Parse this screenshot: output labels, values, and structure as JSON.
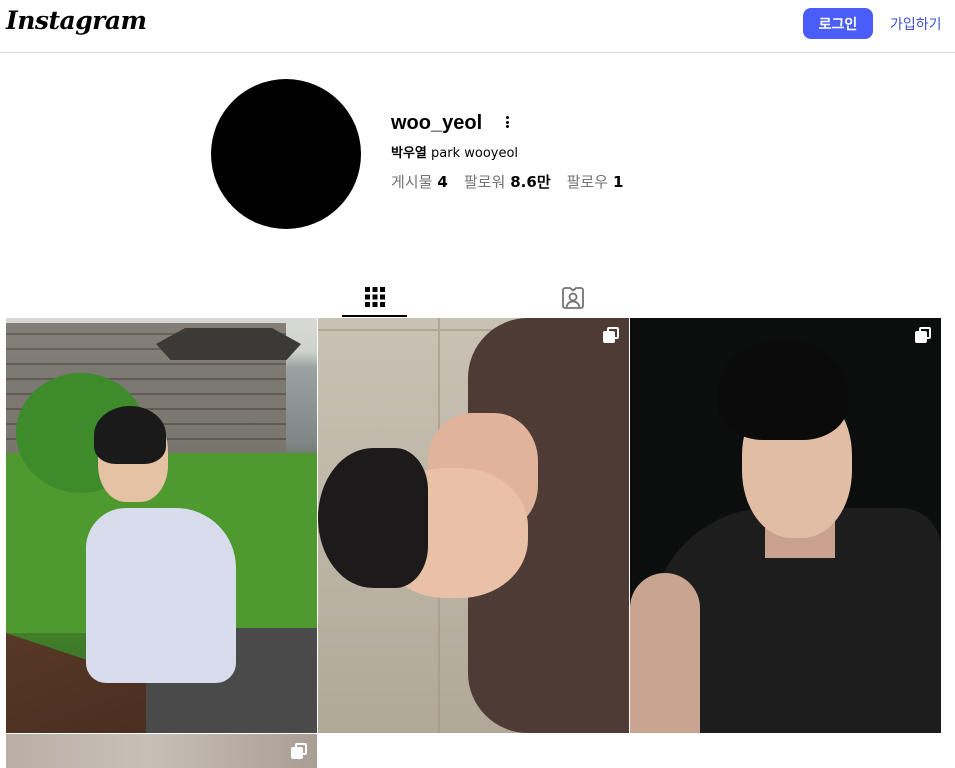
{
  "header": {
    "logo_text": "Instagram",
    "login_label": "로그인",
    "signup_label": "가입하기",
    "login_color": "#4a5df9"
  },
  "profile": {
    "username": "woo_yeol",
    "name_bold": "박우열",
    "name_rest": " park wooyeol",
    "stats": [
      {
        "label": "게시물",
        "value": "4"
      },
      {
        "label": "팔로워",
        "value": "8.6만"
      },
      {
        "label": "팔로우",
        "value": "1"
      }
    ],
    "more_icon": "more-options-icon"
  },
  "tabs": [
    {
      "name": "posts",
      "icon": "grid-icon",
      "active": true
    },
    {
      "name": "tagged",
      "icon": "tagged-person-icon",
      "active": false
    }
  ],
  "posts": [
    {
      "id": "post-1",
      "multi": false
    },
    {
      "id": "post-2",
      "multi": true
    },
    {
      "id": "post-3",
      "multi": true
    },
    {
      "id": "post-4",
      "multi": true
    }
  ]
}
